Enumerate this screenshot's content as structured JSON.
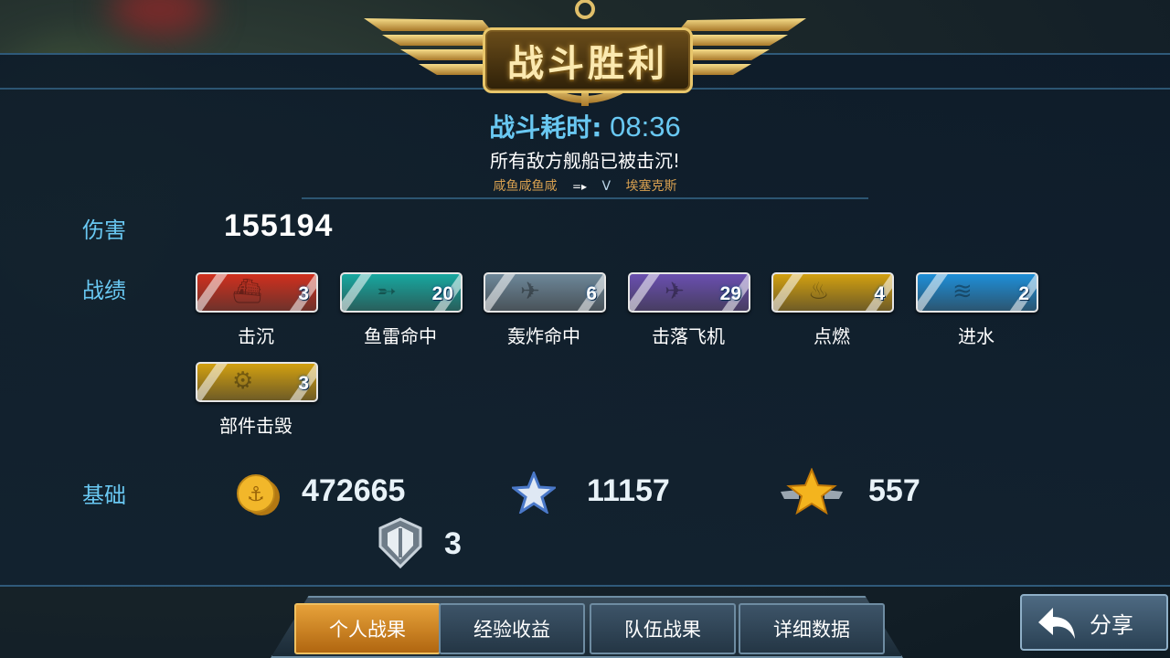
{
  "header": {
    "title": "战斗胜利",
    "time_label": "战斗耗时:",
    "time_value": "08:36",
    "message": "所有敌方舰船已被击沉!",
    "player_left": "咸鱼咸鱼咸",
    "vs_arrow": "=▸",
    "vs_text": "V",
    "player_right": "埃塞克斯"
  },
  "damage": {
    "label": "伤害",
    "value": "155194"
  },
  "achievements": {
    "label": "战绩",
    "items": [
      {
        "name": "击沉",
        "count": "3",
        "icon": "sinking-ship-icon",
        "color": "#d0301e"
      },
      {
        "name": "鱼雷命中",
        "count": "20",
        "icon": "torpedo-icon",
        "color": "#17a8a0"
      },
      {
        "name": "轰炸命中",
        "count": "6",
        "icon": "bomber-icon",
        "color": "#6d8799"
      },
      {
        "name": "击落飞机",
        "count": "29",
        "icon": "planes-shot-down-icon",
        "color": "#6a4fb0"
      },
      {
        "name": "点燃",
        "count": "4",
        "icon": "fire-icon",
        "color": "#d2a010"
      },
      {
        "name": "进水",
        "count": "2",
        "icon": "flooding-icon",
        "color": "#1e8fd8"
      },
      {
        "name": "部件击毁",
        "count": "3",
        "icon": "gear-broken-icon",
        "color": "#d2a010"
      }
    ]
  },
  "base": {
    "label": "基础",
    "coins": "472665",
    "exp": "11157",
    "rank_points": "557",
    "shield": "3"
  },
  "tabs": [
    "个人战果",
    "经验收益",
    "队伍战果",
    "详细数据"
  ],
  "active_tab": 0,
  "share": {
    "label": "分享"
  }
}
